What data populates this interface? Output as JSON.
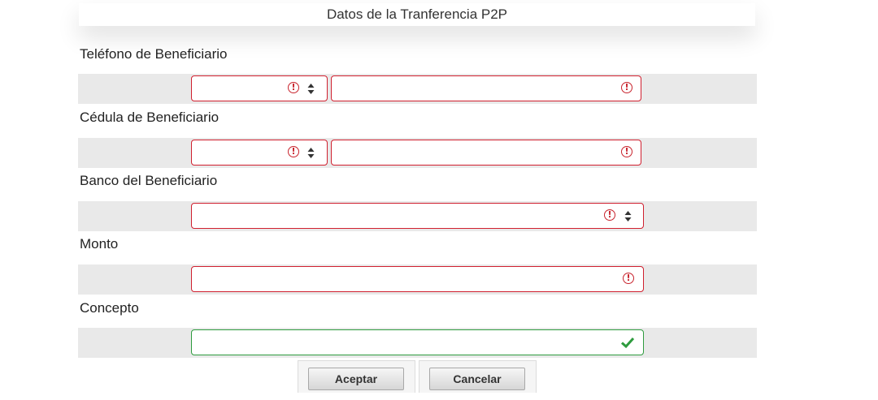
{
  "form": {
    "title": "Datos de la Tranferencia P2P",
    "fields": {
      "telefono": {
        "label": "Teléfono de Beneficiario",
        "prefix_value": "",
        "number_value": ""
      },
      "cedula": {
        "label": "Cédula de Beneficiario",
        "type_value": "",
        "number_value": ""
      },
      "banco": {
        "label": "Banco del Beneficiario",
        "value": ""
      },
      "monto": {
        "label": "Monto",
        "value": ""
      },
      "concepto": {
        "label": "Concepto",
        "value": ""
      }
    },
    "buttons": {
      "accept": "Aceptar",
      "cancel": "Cancelar"
    }
  },
  "icons": {
    "invalid": "exclamation-circle-icon",
    "select_arrows": "sort-arrows-icon",
    "valid": "checkmark-icon"
  },
  "colors": {
    "invalid_border": "#d0202f",
    "valid_border": "#2e9b3e",
    "row_background": "#e9e9e9"
  }
}
